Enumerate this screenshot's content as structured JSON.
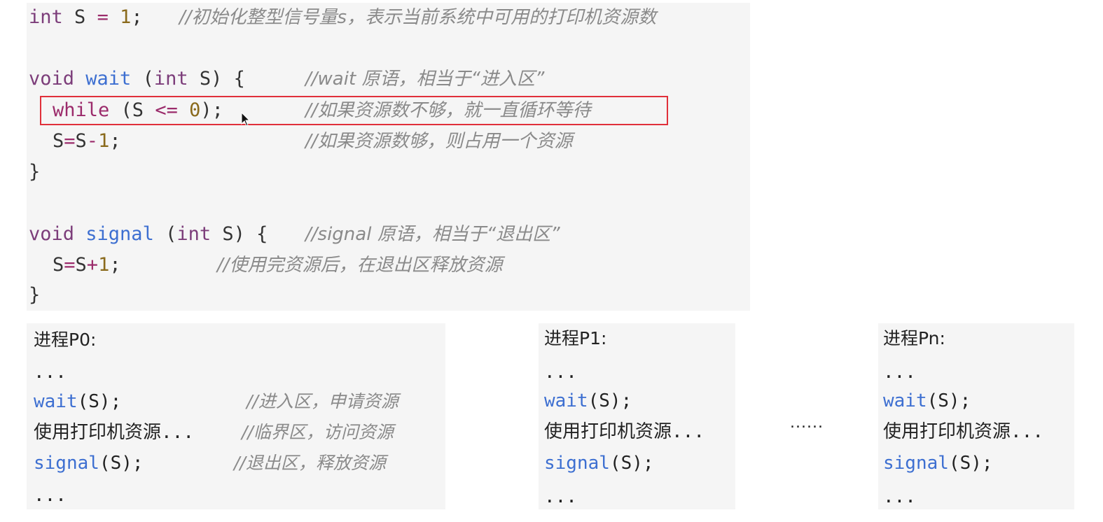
{
  "code": {
    "l1": {
      "kw": "int",
      "var": " S ",
      "op": "=",
      "num": " 1",
      "end": ";",
      "comment": "//初始化整型信号量s，表示当前系统中可用的打印机资源数"
    },
    "l2": {
      "kw1": "void",
      "fn": " wait",
      "rest1": " (",
      "kw2": "int",
      "rest2": " S) {",
      "comment": "//wait 原语，相当于“进入区”"
    },
    "l3": {
      "kw": "while",
      "rest1": " (S ",
      "op": "<=",
      "num": " 0",
      "rest2": ");",
      "comment": "//如果资源数不够，就一直循环等待"
    },
    "l4": {
      "a": "S",
      "op1": "=",
      "b": "S",
      "op2": "-",
      "num": "1",
      "end": ";",
      "comment": "//如果资源数够，则占用一个资源"
    },
    "l5": {
      "text": "}"
    },
    "l6": {
      "kw1": "void",
      "fn": " signal",
      "rest1": " (",
      "kw2": "int",
      "rest2": " S) {",
      "comment": "//signal 原语，相当于“退出区”"
    },
    "l7": {
      "a": "S",
      "op1": "=",
      "b": "S",
      "op2": "+",
      "num": "1",
      "end": ";",
      "comment": "//使用完资源后，在退出区释放资源"
    },
    "l8": {
      "text": "}"
    }
  },
  "processes": [
    {
      "title": "进程P0:",
      "dots_top": "...",
      "wait_fn": "wait",
      "wait_rest": "(S);",
      "wait_comment": "//进入区，申请资源",
      "use": "使用打印机资源",
      "use_dots": "...",
      "use_comment": "//临界区，访问资源",
      "signal_fn": "signal",
      "signal_rest": "(S);",
      "signal_comment": "//退出区，释放资源",
      "dots_bottom": "..."
    },
    {
      "title": "进程P1:",
      "dots_top": "...",
      "wait_fn": "wait",
      "wait_rest": "(S);",
      "use": "使用打印机资源",
      "use_dots": "...",
      "signal_fn": "signal",
      "signal_rest": "(S);",
      "dots_bottom": "..."
    },
    {
      "title": "进程Pn:",
      "dots_top": "...",
      "wait_fn": "wait",
      "wait_rest": "(S);",
      "use": "使用打印机资源",
      "use_dots": "...",
      "signal_fn": "signal",
      "signal_rest": "(S);",
      "dots_bottom": "..."
    }
  ],
  "between_ellipsis": "......",
  "colors": {
    "keyword": "#7c3d7a",
    "function": "#3d6fd1",
    "number": "#8a6a1c",
    "comment": "#8a8a8a",
    "highlight": "#e0303a"
  },
  "icons": {
    "cursor": "mouse-pointer-icon"
  }
}
